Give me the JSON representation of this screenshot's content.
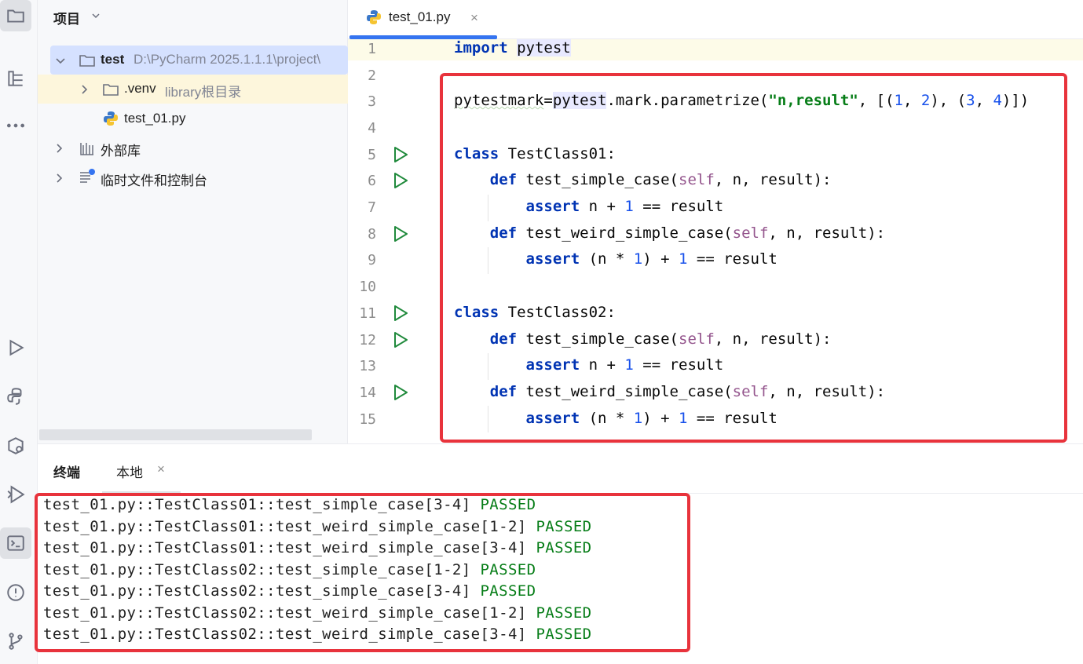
{
  "project_panel": {
    "title": "项目",
    "tree": [
      {
        "label": "test",
        "hint": "D:\\PyCharm 2025.1.1.1\\project\\"
      },
      {
        "label": ".venv",
        "hint": "library根目录"
      },
      {
        "label": "test_01.py",
        "hint": ""
      },
      {
        "label": "外部库",
        "hint": ""
      },
      {
        "label": "临时文件和控制台",
        "hint": ""
      }
    ]
  },
  "editor": {
    "tab_label": "test_01.py",
    "tab_close": "×",
    "line_numbers": [
      "1",
      "2",
      "3",
      "4",
      "5",
      "6",
      "7",
      "8",
      "9",
      "10",
      "11",
      "12",
      "13",
      "14",
      "15"
    ],
    "code": {
      "l1_kw": "import",
      "l1_mod": "pytest",
      "l3_var": "pytestmark",
      "l3_eq": "=",
      "l3_mod": "pytest",
      "l3_rest": ".mark.parametrize(",
      "l3_str": "\"n,result\"",
      "l3_list_open": ", [(",
      "l3_n1": "1",
      "l3_c1": ", ",
      "l3_n2": "2",
      "l3_mid": "), (",
      "l3_n3": "3",
      "l3_c2": ", ",
      "l3_n4": "4",
      "l3_close": ")])",
      "class_kw": "class",
      "class1_name": " TestClass01:",
      "class2_name": " TestClass02:",
      "def_kw": "def",
      "simple_name": " test_simple_case(",
      "weird_name": " test_weird_simple_case(",
      "self": "self",
      "params_tail": ", n, result):",
      "assert_kw": "assert",
      "assert1_a": " n + ",
      "one": "1",
      "assert_tail": " == result",
      "assert2_a": " (n * ",
      "assert2_b": ") + "
    }
  },
  "terminal": {
    "title": "终端",
    "tab_label": "本地",
    "tab_close": "×",
    "lines": [
      {
        "text": "test_01.py::TestClass01::test_simple_case[3-4] ",
        "status": "PASSED"
      },
      {
        "text": "test_01.py::TestClass01::test_weird_simple_case[1-2] ",
        "status": "PASSED"
      },
      {
        "text": "test_01.py::TestClass01::test_weird_simple_case[3-4] ",
        "status": "PASSED"
      },
      {
        "text": "test_01.py::TestClass02::test_simple_case[1-2] ",
        "status": "PASSED"
      },
      {
        "text": "test_01.py::TestClass02::test_simple_case[3-4] ",
        "status": "PASSED"
      },
      {
        "text": "test_01.py::TestClass02::test_weird_simple_case[1-2] ",
        "status": "PASSED"
      },
      {
        "text": "test_01.py::TestClass02::test_weird_simple_case[3-4] ",
        "status": "PASSED"
      }
    ]
  },
  "activity_bar": {
    "icons": [
      "folder-icon",
      "structure-icon",
      "more-icon",
      "run-icon",
      "python-console-icon",
      "services-icon",
      "debug-icon",
      "terminal-icon",
      "problems-icon",
      "git-icon"
    ]
  },
  "colors": {
    "accent": "#3574f0",
    "annotation_red": "#e8333c",
    "keyword": "#0033b3",
    "string": "#067d17",
    "number": "#1750eb",
    "self": "#94558d",
    "passed": "#067d17"
  }
}
